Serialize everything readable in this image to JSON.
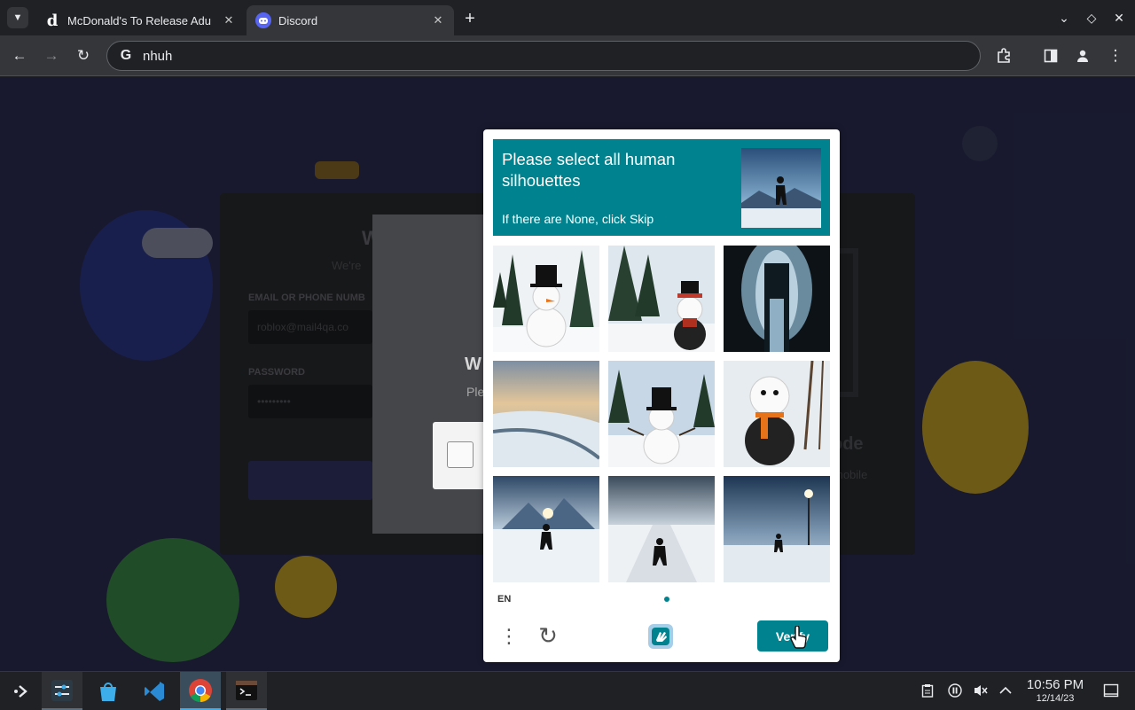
{
  "browser": {
    "tabs": [
      {
        "title": "McDonald's To Release Adu",
        "favicon": "d-letter-icon",
        "active": false
      },
      {
        "title": "Discord",
        "favicon": "discord-icon",
        "active": true
      }
    ],
    "address": "nhuh"
  },
  "discord_bg": {
    "welcome_char": "W",
    "welcome_sub": "We're",
    "email_label": "EMAIL OR PHONE NUMB",
    "email_value": "roblox@mail4qa.co",
    "password_label": "PASSWORD",
    "password_value": "•••••••••",
    "code_text": "ode",
    "mobile_text": "mobile",
    "modal_heading": "W",
    "modal_sub": "Ple"
  },
  "captcha": {
    "prompt_title": "Please select all human silhouettes",
    "prompt_sub": "If there are None, click Skip",
    "language": "EN",
    "verify_label": "Verify",
    "tiles": [
      {
        "subject": "snowman in forest",
        "type": "snowman"
      },
      {
        "subject": "snowman by pines",
        "type": "snowman"
      },
      {
        "subject": "dark figure in cave light",
        "type": "cave"
      },
      {
        "subject": "snowy landscape",
        "type": "landscape"
      },
      {
        "subject": "snowman with top hat",
        "type": "snowman"
      },
      {
        "subject": "snowman with scarf",
        "type": "snowman"
      },
      {
        "subject": "person walking toward mountains",
        "type": "person"
      },
      {
        "subject": "person walking on snowy road",
        "type": "person"
      },
      {
        "subject": "person under streetlight",
        "type": "person"
      }
    ],
    "colors": {
      "accent": "#00838f"
    }
  },
  "taskbar": {
    "apps": [
      "application-launcher-icon",
      "system-settings-icon",
      "discover-store-icon",
      "vscode-icon",
      "chrome-icon",
      "terminal-icon"
    ],
    "time": "10:56 PM",
    "date": "12/14/23"
  }
}
